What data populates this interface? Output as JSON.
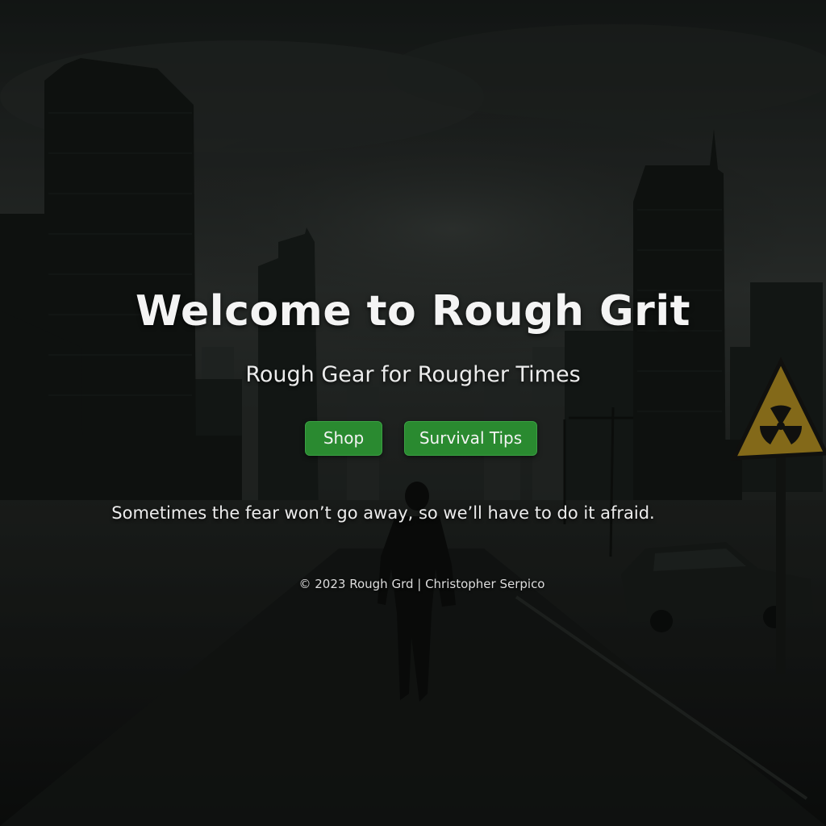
{
  "hero": {
    "title": "Welcome to Rough Grit",
    "subtitle": "Rough Gear for Rougher Times"
  },
  "nav": {
    "shop_label": "Shop",
    "tips_label": "Survival Tips"
  },
  "quote": "Sometimes the fear won’t go away, so we’ll have to do it afraid.",
  "footer": {
    "text": "© 2023 Rough Grd | Christopher Serpico"
  },
  "colors": {
    "button": "#2a8a30",
    "text": "#f2f2f2",
    "sign": "#c9a227"
  },
  "icons": {
    "hazard_sign": "radiation-warning-icon"
  }
}
